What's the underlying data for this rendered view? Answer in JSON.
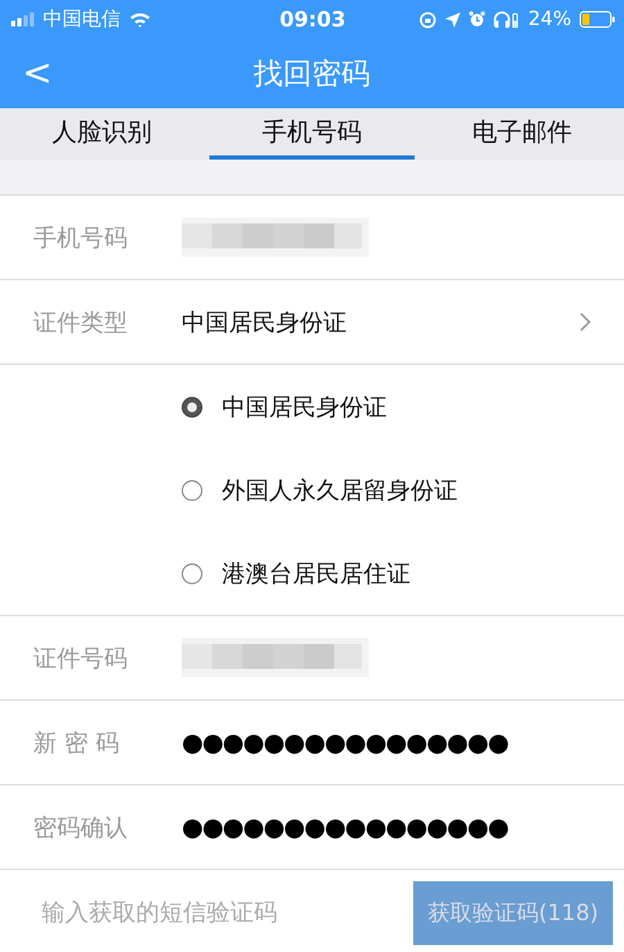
{
  "status_bar": {
    "carrier": "中国电信",
    "time": "09:03",
    "battery_percent": "24%"
  },
  "nav": {
    "back": "<",
    "title": "找回密码"
  },
  "tabs": [
    {
      "label": "人脸识别",
      "selected": false
    },
    {
      "label": "手机号码",
      "selected": true
    },
    {
      "label": "电子邮件",
      "selected": false
    }
  ],
  "form": {
    "rows": [
      {
        "kind": "redacted",
        "label": "手机号码"
      },
      {
        "kind": "select",
        "label": "证件类型",
        "value": "中国居民身份证"
      },
      {
        "kind": "options",
        "options": [
          {
            "label": "中国居民身份证",
            "selected": true
          },
          {
            "label": "外国人永久居留身份证",
            "selected": false
          },
          {
            "label": "港澳台居民居住证",
            "selected": false
          }
        ]
      },
      {
        "kind": "redacted",
        "label": "证件号码"
      },
      {
        "kind": "password",
        "label": "新 密 码",
        "value": "●●●●●●●●●●●●●●●●"
      },
      {
        "kind": "password",
        "label": "密码确认",
        "value": "●●●●●●●●●●●●●●●●"
      },
      {
        "kind": "sms",
        "placeholder": "输入获取的短信验证码",
        "button": "获取验证码(118)",
        "disabled": true
      }
    ]
  }
}
